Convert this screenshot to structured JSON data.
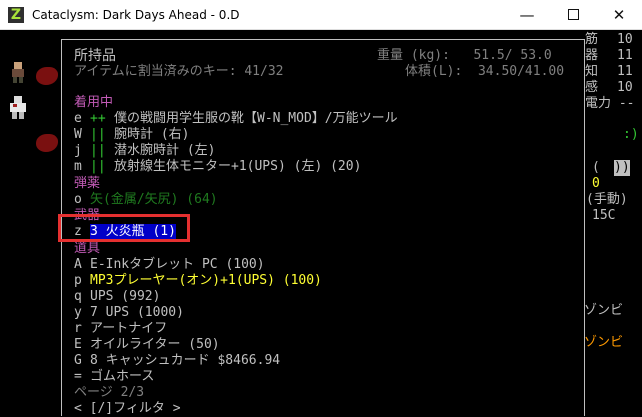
{
  "window": {
    "icon_letter": "Z",
    "title": "Cataclysm: Dark Days Ahead - 0.D",
    "minimize_glyph": "—",
    "close_glyph": "✕"
  },
  "colors": {
    "section": "#c25bb6",
    "green": "#33c733",
    "gray": "#c0c0c0",
    "yellow": "#ffff33",
    "cyan": "#2aa8a8",
    "orange": "#ff9a00",
    "selection": "#0000c8",
    "annotation": "#e53030"
  },
  "inventory": {
    "title": "所持品",
    "hotkey_count": "アイテムに割当済みのキー: 41/32",
    "weight": "重量 (kg):   51.5/ 53.0",
    "volume": "体積(L):  34.50/41.00",
    "sections": {
      "worn": "着用中",
      "ammo": "弾薬",
      "weapon": "武器",
      "tools": "道具"
    },
    "items": [
      {
        "key": "e",
        "mark": "++",
        "name": "僕の戦闘用学生服の靴【W-N_MOD】/万能ツール"
      },
      {
        "key": "W",
        "mark": "||",
        "name": "腕時計 (右)"
      },
      {
        "key": "j",
        "mark": "||",
        "name": "潜水腕時計 (左)"
      },
      {
        "key": "m",
        "mark": "||",
        "name": "放射線生体モニター+1(UPS) (左) (20)"
      },
      {
        "key": "o",
        "mark": "",
        "name": "矢(金属/矢尻) (64)"
      },
      {
        "key": "z",
        "mark": "",
        "name": "3 火炎瓶 (1)"
      },
      {
        "key": "A",
        "mark": "",
        "name": "E-Inkタブレット PC (100)"
      },
      {
        "key": "p",
        "mark": "",
        "name": "MP3プレーヤー(オン)+1(UPS) (100)"
      },
      {
        "key": "q",
        "mark": "",
        "name": "UPS (992)"
      },
      {
        "key": "y",
        "mark": "",
        "name": "7 UPS (1000)"
      },
      {
        "key": "r",
        "mark": "",
        "name": "アートナイフ"
      },
      {
        "key": "E",
        "mark": "",
        "name": "オイルライター (50)"
      },
      {
        "key": "G",
        "mark": "",
        "name": "8 キャッシュカード $8466.94"
      },
      {
        "key": "=",
        "mark": "",
        "name": "ゴムホース"
      }
    ],
    "page": "ページ 2/3",
    "filter": "< [/]フィルタ >"
  },
  "sidebar": {
    "stats": [
      {
        "label": "筋",
        "value": "10"
      },
      {
        "label": "器",
        "value": "11"
      },
      {
        "label": "知",
        "value": "11"
      },
      {
        "label": "感",
        "value": "10"
      }
    ],
    "power": "電力 --",
    "face": ":)",
    "bracket_left": "(",
    "bracket_right": "))",
    "zero": "0",
    "manual": "(手動)",
    "temp": "15C",
    "zombie_1": "ゾンビ",
    "zombie_2": "ゾンビ"
  }
}
